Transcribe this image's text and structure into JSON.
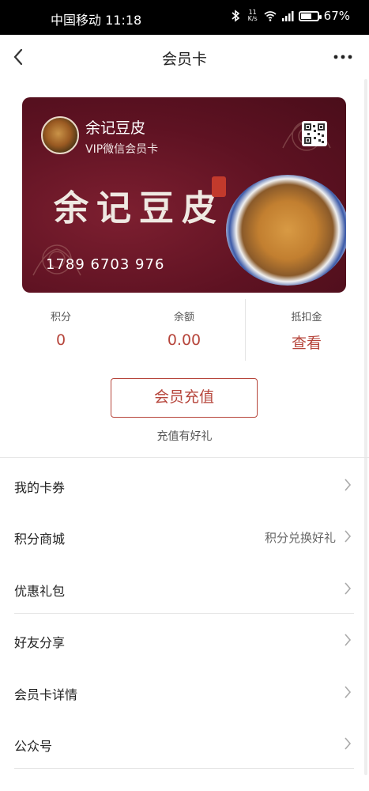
{
  "status_bar": {
    "carrier_time": "中国移动 11:18",
    "speed_value": "11",
    "speed_unit": "K/s",
    "battery": "67%",
    "battery_level": 0.67
  },
  "nav": {
    "title": "会员卡"
  },
  "card": {
    "brand": "余记豆皮",
    "level": "VIP微信会员卡",
    "big_title": "余记豆皮",
    "number": "1789 6703 976",
    "background_color": "#5e1222"
  },
  "stats": [
    {
      "label": "积分",
      "value": "0"
    },
    {
      "label": "余额",
      "value": "0.00"
    },
    {
      "label": "抵扣金",
      "value": "查看"
    }
  ],
  "recharge": {
    "button_label": "会员充值",
    "subtitle": "充值有好礼",
    "accent_color": "#b6453b"
  },
  "menu": [
    {
      "label": "我的卡券",
      "hint": ""
    },
    {
      "label": "积分商城",
      "hint": "积分兑换好礼"
    },
    {
      "label": "优惠礼包",
      "hint": ""
    },
    {
      "label": "好友分享",
      "hint": ""
    },
    {
      "label": "会员卡详情",
      "hint": ""
    },
    {
      "label": "公众号",
      "hint": ""
    }
  ]
}
